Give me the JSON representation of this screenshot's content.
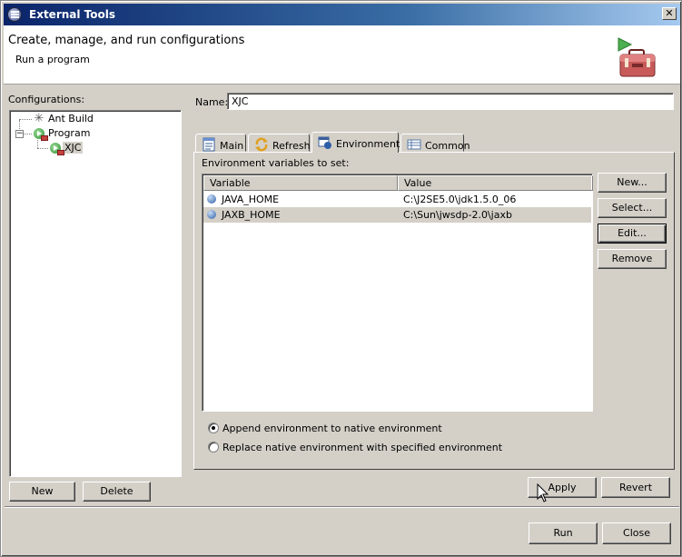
{
  "window": {
    "title": "External Tools",
    "close_glyph": "✕"
  },
  "header": {
    "title": "Create, manage, and run configurations",
    "subtitle": "Run a program",
    "banner_icon": "toolbox-run-icon"
  },
  "configurations": {
    "label": "Configurations:",
    "tree": [
      {
        "label": "Ant Build",
        "icon": "ant-icon",
        "level": 0,
        "selected": false
      },
      {
        "label": "Program",
        "icon": "program-icon",
        "level": 0,
        "expanded": true,
        "selected": false
      },
      {
        "label": "XJC",
        "icon": "program-icon",
        "level": 1,
        "selected": true
      }
    ],
    "new_label": "New",
    "delete_label": "Delete"
  },
  "name": {
    "label": "Name:",
    "value": "XJC"
  },
  "tabs": [
    {
      "label": "Main",
      "icon": "main-icon",
      "active": false
    },
    {
      "label": "Refresh",
      "icon": "refresh-icon",
      "active": false
    },
    {
      "label": "Environment",
      "icon": "environment-icon",
      "active": true
    },
    {
      "label": "Common",
      "icon": "common-icon",
      "active": false
    }
  ],
  "environment": {
    "label": "Environment variables to set:",
    "columns": [
      "Variable",
      "Value"
    ],
    "rows": [
      {
        "variable": "JAVA_HOME",
        "value": "C:\\J2SE5.0\\jdk1.5.0_06",
        "selected": false
      },
      {
        "variable": "JAXB_HOME",
        "value": "C:\\Sun\\jwsdp-2.0\\jaxb",
        "selected": true
      }
    ],
    "buttons": {
      "new": "New...",
      "select": "Select...",
      "edit": "Edit...",
      "remove": "Remove"
    },
    "options": [
      {
        "label": "Append environment to native environment",
        "checked": true
      },
      {
        "label": "Replace native environment with specified environment",
        "checked": false
      }
    ]
  },
  "actions": {
    "apply": "Apply",
    "revert": "Revert",
    "run": "Run",
    "close": "Close"
  }
}
